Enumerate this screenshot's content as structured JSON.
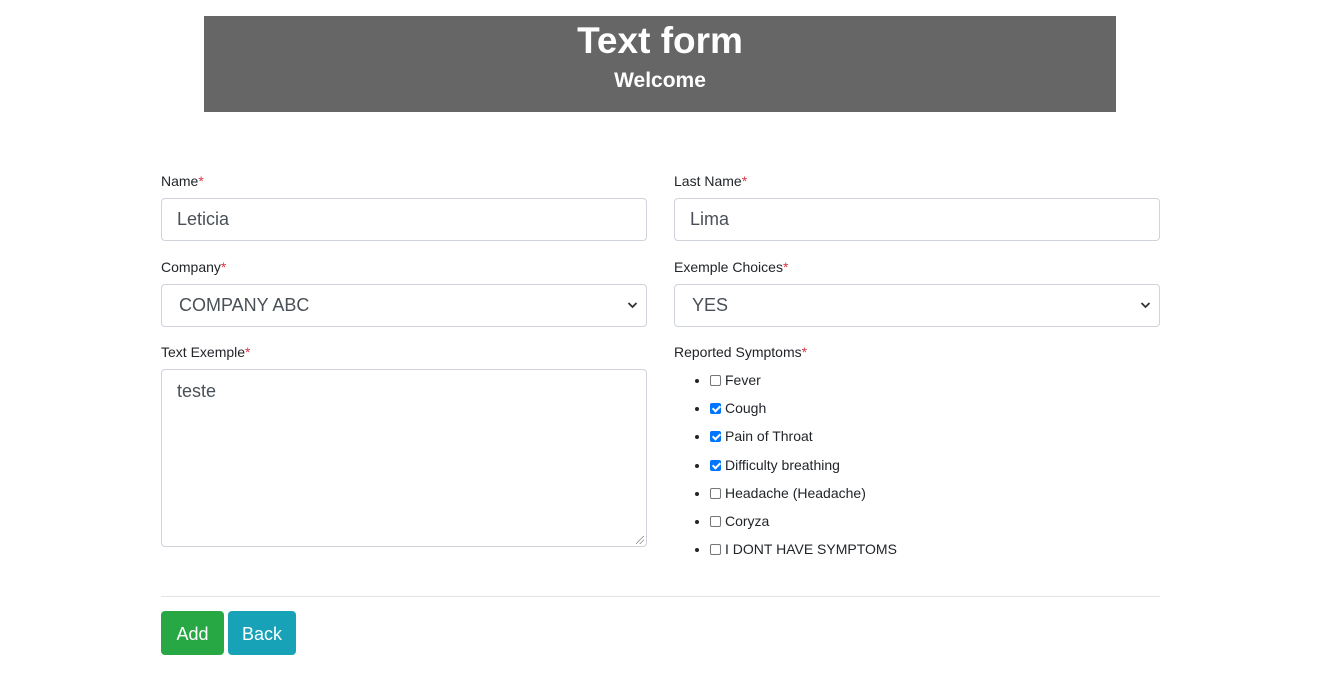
{
  "header": {
    "title": "Text form",
    "subtitle": "Welcome"
  },
  "form": {
    "required_marker": "*",
    "name": {
      "label": "Name",
      "value": "Leticia"
    },
    "last_name": {
      "label": "Last Name",
      "value": "Lima"
    },
    "company": {
      "label": "Company",
      "selected": "COMPANY ABC"
    },
    "exemple_choices": {
      "label": "Exemple Choices",
      "selected": "YES"
    },
    "text_exemple": {
      "label": "Text Exemple",
      "value": "teste"
    },
    "symptoms": {
      "label": "Reported Symptoms",
      "items": [
        {
          "label": "Fever",
          "checked": false
        },
        {
          "label": "Cough",
          "checked": true
        },
        {
          "label": "Pain of Throat",
          "checked": true
        },
        {
          "label": "Difficulty breathing",
          "checked": true
        },
        {
          "label": "Headache (Headache)",
          "checked": false
        },
        {
          "label": "Coryza",
          "checked": false
        },
        {
          "label": "I DONT HAVE SYMPTOMS",
          "checked": false
        }
      ]
    }
  },
  "actions": {
    "add_label": "Add",
    "back_label": "Back"
  },
  "colors": {
    "header_bg": "#666666",
    "required": "#dc3545",
    "add_button": "#28a745",
    "back_button": "#17a2b8",
    "checkbox_checked": "#0075ff"
  }
}
